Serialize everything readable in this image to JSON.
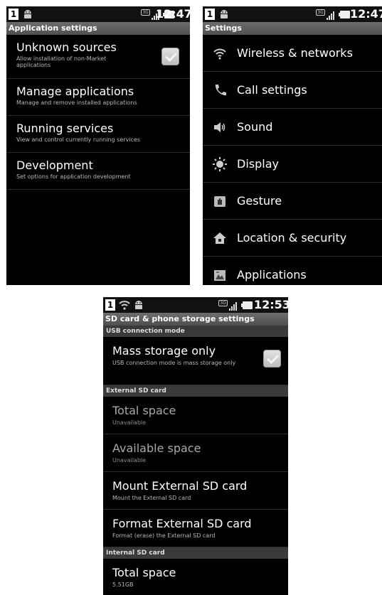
{
  "screen1": {
    "status_time": "12:47",
    "title": "Application settings",
    "items": [
      {
        "title": "Unknown sources",
        "subtitle": "Allow installation of non-Market applications",
        "checked": true
      },
      {
        "title": "Manage applications",
        "subtitle": "Manage and remove installed applications"
      },
      {
        "title": "Running services",
        "subtitle": "View and control currently running services"
      },
      {
        "title": "Development",
        "subtitle": "Set options for application development"
      }
    ]
  },
  "screen2": {
    "status_time": "12:47",
    "title": "Settings",
    "items": [
      {
        "label": "Wireless & networks",
        "icon": "wifi-icon"
      },
      {
        "label": "Call settings",
        "icon": "phone-icon"
      },
      {
        "label": "Sound",
        "icon": "speaker-icon"
      },
      {
        "label": "Display",
        "icon": "brightness-icon"
      },
      {
        "label": "Gesture",
        "icon": "gesture-icon"
      },
      {
        "label": "Location & security",
        "icon": "lock-house-icon"
      },
      {
        "label": "Applications",
        "icon": "applications-icon"
      }
    ]
  },
  "screen3": {
    "status_time": "12:53",
    "title": "SD card & phone storage settings",
    "usb_section": "USB connection mode",
    "usb_item": {
      "title": "Mass storage only",
      "subtitle": "USB connection mode is mass storage only",
      "checked": true
    },
    "external_section": "External SD card",
    "external_items": [
      {
        "title": "Total space",
        "subtitle": "Unavailable",
        "enabled": false
      },
      {
        "title": "Available space",
        "subtitle": "Unavailable",
        "enabled": false
      },
      {
        "title": "Mount External SD card",
        "subtitle": "Mount the External SD card",
        "enabled": true
      },
      {
        "title": "Format External SD card",
        "subtitle": "Format (erase) the External SD card",
        "enabled": true
      }
    ],
    "internal_section": "Internal SD card",
    "internal_items": [
      {
        "title": "Total space",
        "subtitle": "5.51GB"
      }
    ]
  },
  "status_icons": {
    "network_badge": "3G",
    "notification_badge": "1"
  },
  "colors": {
    "background": "#000000",
    "titlebar": "#5a5a5a",
    "section_header": "#3a3a3a",
    "primary_text": "#ffffff",
    "secondary_text": "#b8b8b8"
  }
}
